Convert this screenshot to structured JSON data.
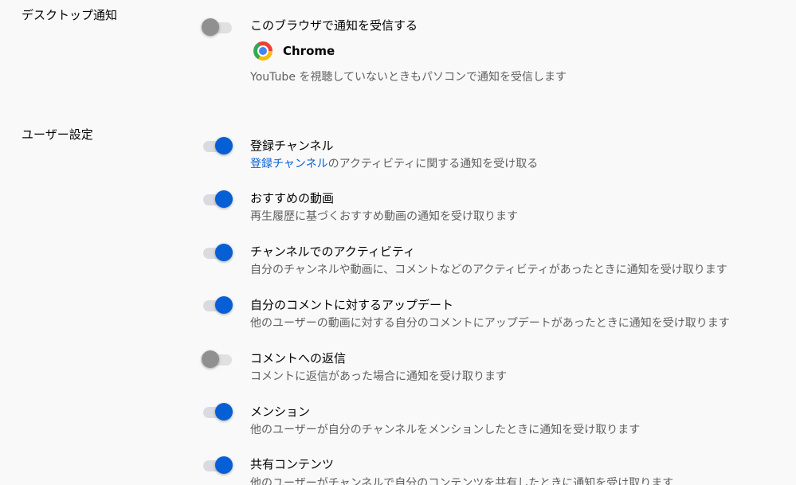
{
  "desktop_section": {
    "label": "デスクトップ通知",
    "toggle_title": "このブラウザで通知を受信する",
    "toggle_on": false,
    "browser_icon": "chrome-icon",
    "browser_name": "Chrome",
    "description": "YouTube を視聴していないときもパソコンで通知を受信します"
  },
  "user_section": {
    "label": "ユーザー設定",
    "items": [
      {
        "title": "登録チャンネル",
        "desc_link": "登録チャンネル",
        "desc": "のアクティビティに関する通知を受け取る",
        "on": true
      },
      {
        "title": "おすすめの動画",
        "desc": "再生履歴に基づくおすすめ動画の通知を受け取ります",
        "on": true
      },
      {
        "title": "チャンネルでのアクティビティ",
        "desc": "自分のチャンネルや動画に、コメントなどのアクティビティがあったときに通知を受け取ります",
        "on": true
      },
      {
        "title": "自分のコメントに対するアップデート",
        "desc": "他のユーザーの動画に対する自分のコメントにアップデートがあったときに通知を受け取ります",
        "on": true
      },
      {
        "title": "コメントへの返信",
        "desc": "コメントに返信があった場合に通知を受け取ります",
        "on": false
      },
      {
        "title": "メンション",
        "desc": "他のユーザーが自分のチャンネルをメンションしたときに通知を受け取ります",
        "on": true
      },
      {
        "title": "共有コンテンツ",
        "desc": "他のユーザーがチャンネルで自分のコンテンツを共有したときに通知を受け取ります",
        "on": true
      }
    ]
  },
  "colors": {
    "accent": "#065fd4",
    "knob_off": "#909090",
    "text_primary": "#030303",
    "text_secondary": "#606060",
    "background": "#f9f9f9"
  }
}
